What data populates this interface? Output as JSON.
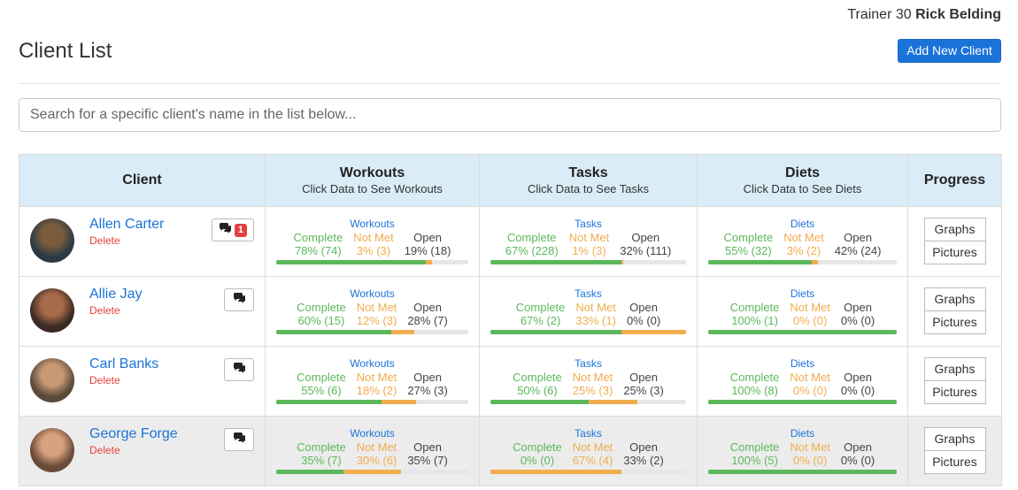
{
  "header": {
    "trainer_prefix": "Trainer 30",
    "trainer_name": "Rick Belding",
    "page_title": "Client List",
    "add_button": "Add New Client"
  },
  "search": {
    "placeholder": "Search for a specific client's name in the list below..."
  },
  "table": {
    "headers": {
      "client": "Client",
      "workouts": "Workouts",
      "workouts_sub": "Click Data to See Workouts",
      "tasks": "Tasks",
      "tasks_sub": "Click Data to See Tasks",
      "diets": "Diets",
      "diets_sub": "Click Data to See Diets",
      "progress": "Progress"
    },
    "labels": {
      "complete": "Complete",
      "not_met": "Not Met",
      "open": "Open",
      "delete": "Delete",
      "graphs": "Graphs",
      "pictures": "Pictures"
    },
    "rows": [
      {
        "name": "Allen Carter",
        "unread": "1",
        "workouts": {
          "title": "Workouts",
          "complete": "78% (74)",
          "not_met": "3% (3)",
          "open": "19% (18)",
          "complete_pct": 78,
          "not_met_pct": 3
        },
        "tasks": {
          "title": "Tasks",
          "complete": "67% (228)",
          "not_met": "1% (3)",
          "open": "32% (111)",
          "complete_pct": 67,
          "not_met_pct": 1
        },
        "diets": {
          "title": "Diets",
          "complete": "55% (32)",
          "not_met": "3% (2)",
          "open": "42% (24)",
          "complete_pct": 55,
          "not_met_pct": 3
        }
      },
      {
        "name": "Allie Jay",
        "unread": "",
        "workouts": {
          "title": "Workouts",
          "complete": "60% (15)",
          "not_met": "12% (3)",
          "open": "28% (7)",
          "complete_pct": 60,
          "not_met_pct": 12
        },
        "tasks": {
          "title": "Tasks",
          "complete": "67% (2)",
          "not_met": "33% (1)",
          "open": "0% (0)",
          "complete_pct": 67,
          "not_met_pct": 33
        },
        "diets": {
          "title": "Diets",
          "complete": "100% (1)",
          "not_met": "0% (0)",
          "open": "0% (0)",
          "complete_pct": 100,
          "not_met_pct": 0
        }
      },
      {
        "name": "Carl Banks",
        "unread": "",
        "workouts": {
          "title": "Workouts",
          "complete": "55% (6)",
          "not_met": "18% (2)",
          "open": "27% (3)",
          "complete_pct": 55,
          "not_met_pct": 18
        },
        "tasks": {
          "title": "Tasks",
          "complete": "50% (6)",
          "not_met": "25% (3)",
          "open": "25% (3)",
          "complete_pct": 50,
          "not_met_pct": 25
        },
        "diets": {
          "title": "Diets",
          "complete": "100% (8)",
          "not_met": "0% (0)",
          "open": "0% (0)",
          "complete_pct": 100,
          "not_met_pct": 0
        }
      },
      {
        "name": "George Forge",
        "unread": "",
        "workouts": {
          "title": "Workouts",
          "complete": "35% (7)",
          "not_met": "30% (6)",
          "open": "35% (7)",
          "complete_pct": 35,
          "not_met_pct": 30
        },
        "tasks": {
          "title": "Tasks",
          "complete": "0% (0)",
          "not_met": "67% (4)",
          "open": "33% (2)",
          "complete_pct": 0,
          "not_met_pct": 67
        },
        "diets": {
          "title": "Diets",
          "complete": "100% (5)",
          "not_met": "0% (0)",
          "open": "0% (0)",
          "complete_pct": 100,
          "not_met_pct": 0
        }
      }
    ]
  },
  "colors": {
    "accent": "#1a73d9",
    "complete": "#5cb85c",
    "not_met": "#f0ad4e",
    "delete": "#e2403f",
    "header_bg": "#d9ecf7"
  },
  "icons": {
    "message": "comments-icon",
    "avatar": "avatar"
  }
}
